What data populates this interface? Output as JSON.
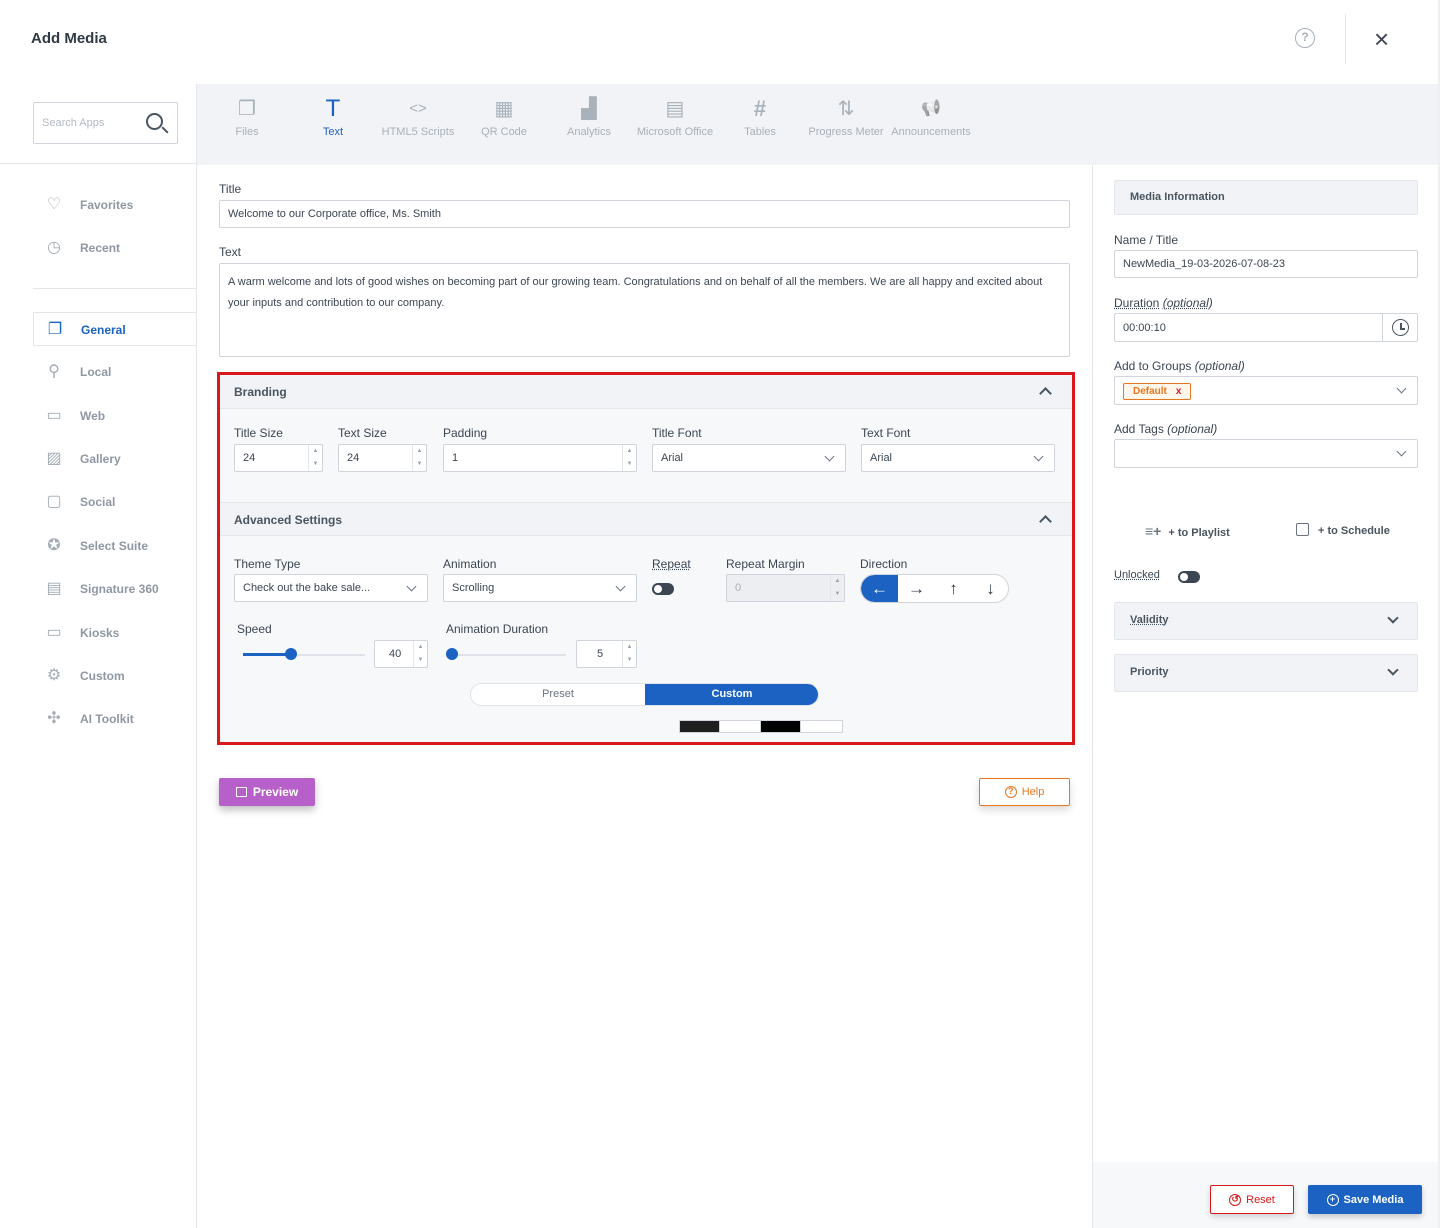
{
  "header": {
    "title": "Add Media",
    "help_icon": "?",
    "close_icon": "×"
  },
  "search": {
    "placeholder": "Search Apps"
  },
  "apps": [
    {
      "label": "Files",
      "icon": "❐",
      "active": false
    },
    {
      "label": "Text",
      "icon": "T",
      "active": true
    },
    {
      "label": "HTML5 Scripts",
      "icon": "<>",
      "active": false
    },
    {
      "label": "QR Code",
      "icon": "▦",
      "active": false
    },
    {
      "label": "Analytics",
      "icon": "▟",
      "active": false
    },
    {
      "label": "Microsoft Office",
      "icon": "▤",
      "active": false
    },
    {
      "label": "Tables",
      "icon": "#",
      "active": false
    },
    {
      "label": "Progress Meter",
      "icon": "⇅",
      "active": false
    },
    {
      "label": "Announcements",
      "icon": "📢",
      "active": false
    }
  ],
  "sidebar": {
    "items": [
      {
        "label": "Favorites",
        "icon": "♡"
      },
      {
        "label": "Recent",
        "icon": "◷"
      },
      {
        "label": "General",
        "icon": "❐"
      },
      {
        "label": "Local",
        "icon": "⚲"
      },
      {
        "label": "Web",
        "icon": "▭"
      },
      {
        "label": "Gallery",
        "icon": "▨"
      },
      {
        "label": "Social",
        "icon": "▢"
      },
      {
        "label": "Select Suite",
        "icon": "✪"
      },
      {
        "label": "Signature 360",
        "icon": "▤"
      },
      {
        "label": "Kiosks",
        "icon": "▭"
      },
      {
        "label": "Custom",
        "icon": "⚙"
      },
      {
        "label": "AI Toolkit",
        "icon": "✣"
      }
    ]
  },
  "form": {
    "title_label": "Title",
    "title_value": "Welcome to our Corporate office, Ms. Smith",
    "text_label": "Text",
    "text_value": "A warm welcome and lots of good wishes on becoming part of our growing team. Congratulations and on behalf of all the members. We are all happy and excited about your inputs and contribution to our company."
  },
  "branding": {
    "header": "Branding",
    "title_size_label": "Title Size",
    "title_size": "24",
    "text_size_label": "Text Size",
    "text_size": "24",
    "padding_label": "Padding",
    "padding": "1",
    "title_font_label": "Title Font",
    "title_font": "Arial",
    "text_font_label": "Text Font",
    "text_font": "Arial"
  },
  "advanced": {
    "header": "Advanced Settings",
    "theme_type_label": "Theme Type",
    "theme_type": "Check out the bake sale...",
    "animation_label": "Animation",
    "animation": "Scrolling",
    "repeat_label": "Repeat",
    "repeat_margin_label": "Repeat Margin",
    "repeat_margin": "0",
    "direction_label": "Direction",
    "directions": [
      "←",
      "→",
      "↑",
      "↓"
    ],
    "speed_label": "Speed",
    "speed": "40",
    "anim_duration_label": "Animation Duration",
    "anim_duration": "5",
    "preset_label": "Preset",
    "custom_label": "Custom",
    "swatch_colors": [
      "#1f1f1f",
      "#ffffff",
      "#000000",
      "#ffffff"
    ]
  },
  "buttons": {
    "preview": "Preview",
    "help": "Help",
    "reset": "Reset",
    "save": "Save Media"
  },
  "media_info": {
    "header": "Media Information",
    "name_label": "Name / Title",
    "name_value": "NewMedia_19-03-2026-07-08-23",
    "duration_label": "Duration",
    "duration_opt": "(optional)",
    "duration_value": "00:00:10",
    "groups_label": "Add to Groups",
    "groups_opt": "(optional)",
    "group_tag": "Default",
    "tag_remove": "x",
    "tags_label": "Add Tags",
    "tags_opt": "(optional)",
    "to_playlist": "+ to Playlist",
    "to_schedule": "+ to Schedule",
    "unlocked_label": "Unlocked",
    "validity": "Validity",
    "priority": "Priority"
  },
  "colors": {
    "accent": "#1b62c2",
    "highlight": "#d7191c",
    "preview": "#b860c9",
    "help": "#e8761e"
  }
}
